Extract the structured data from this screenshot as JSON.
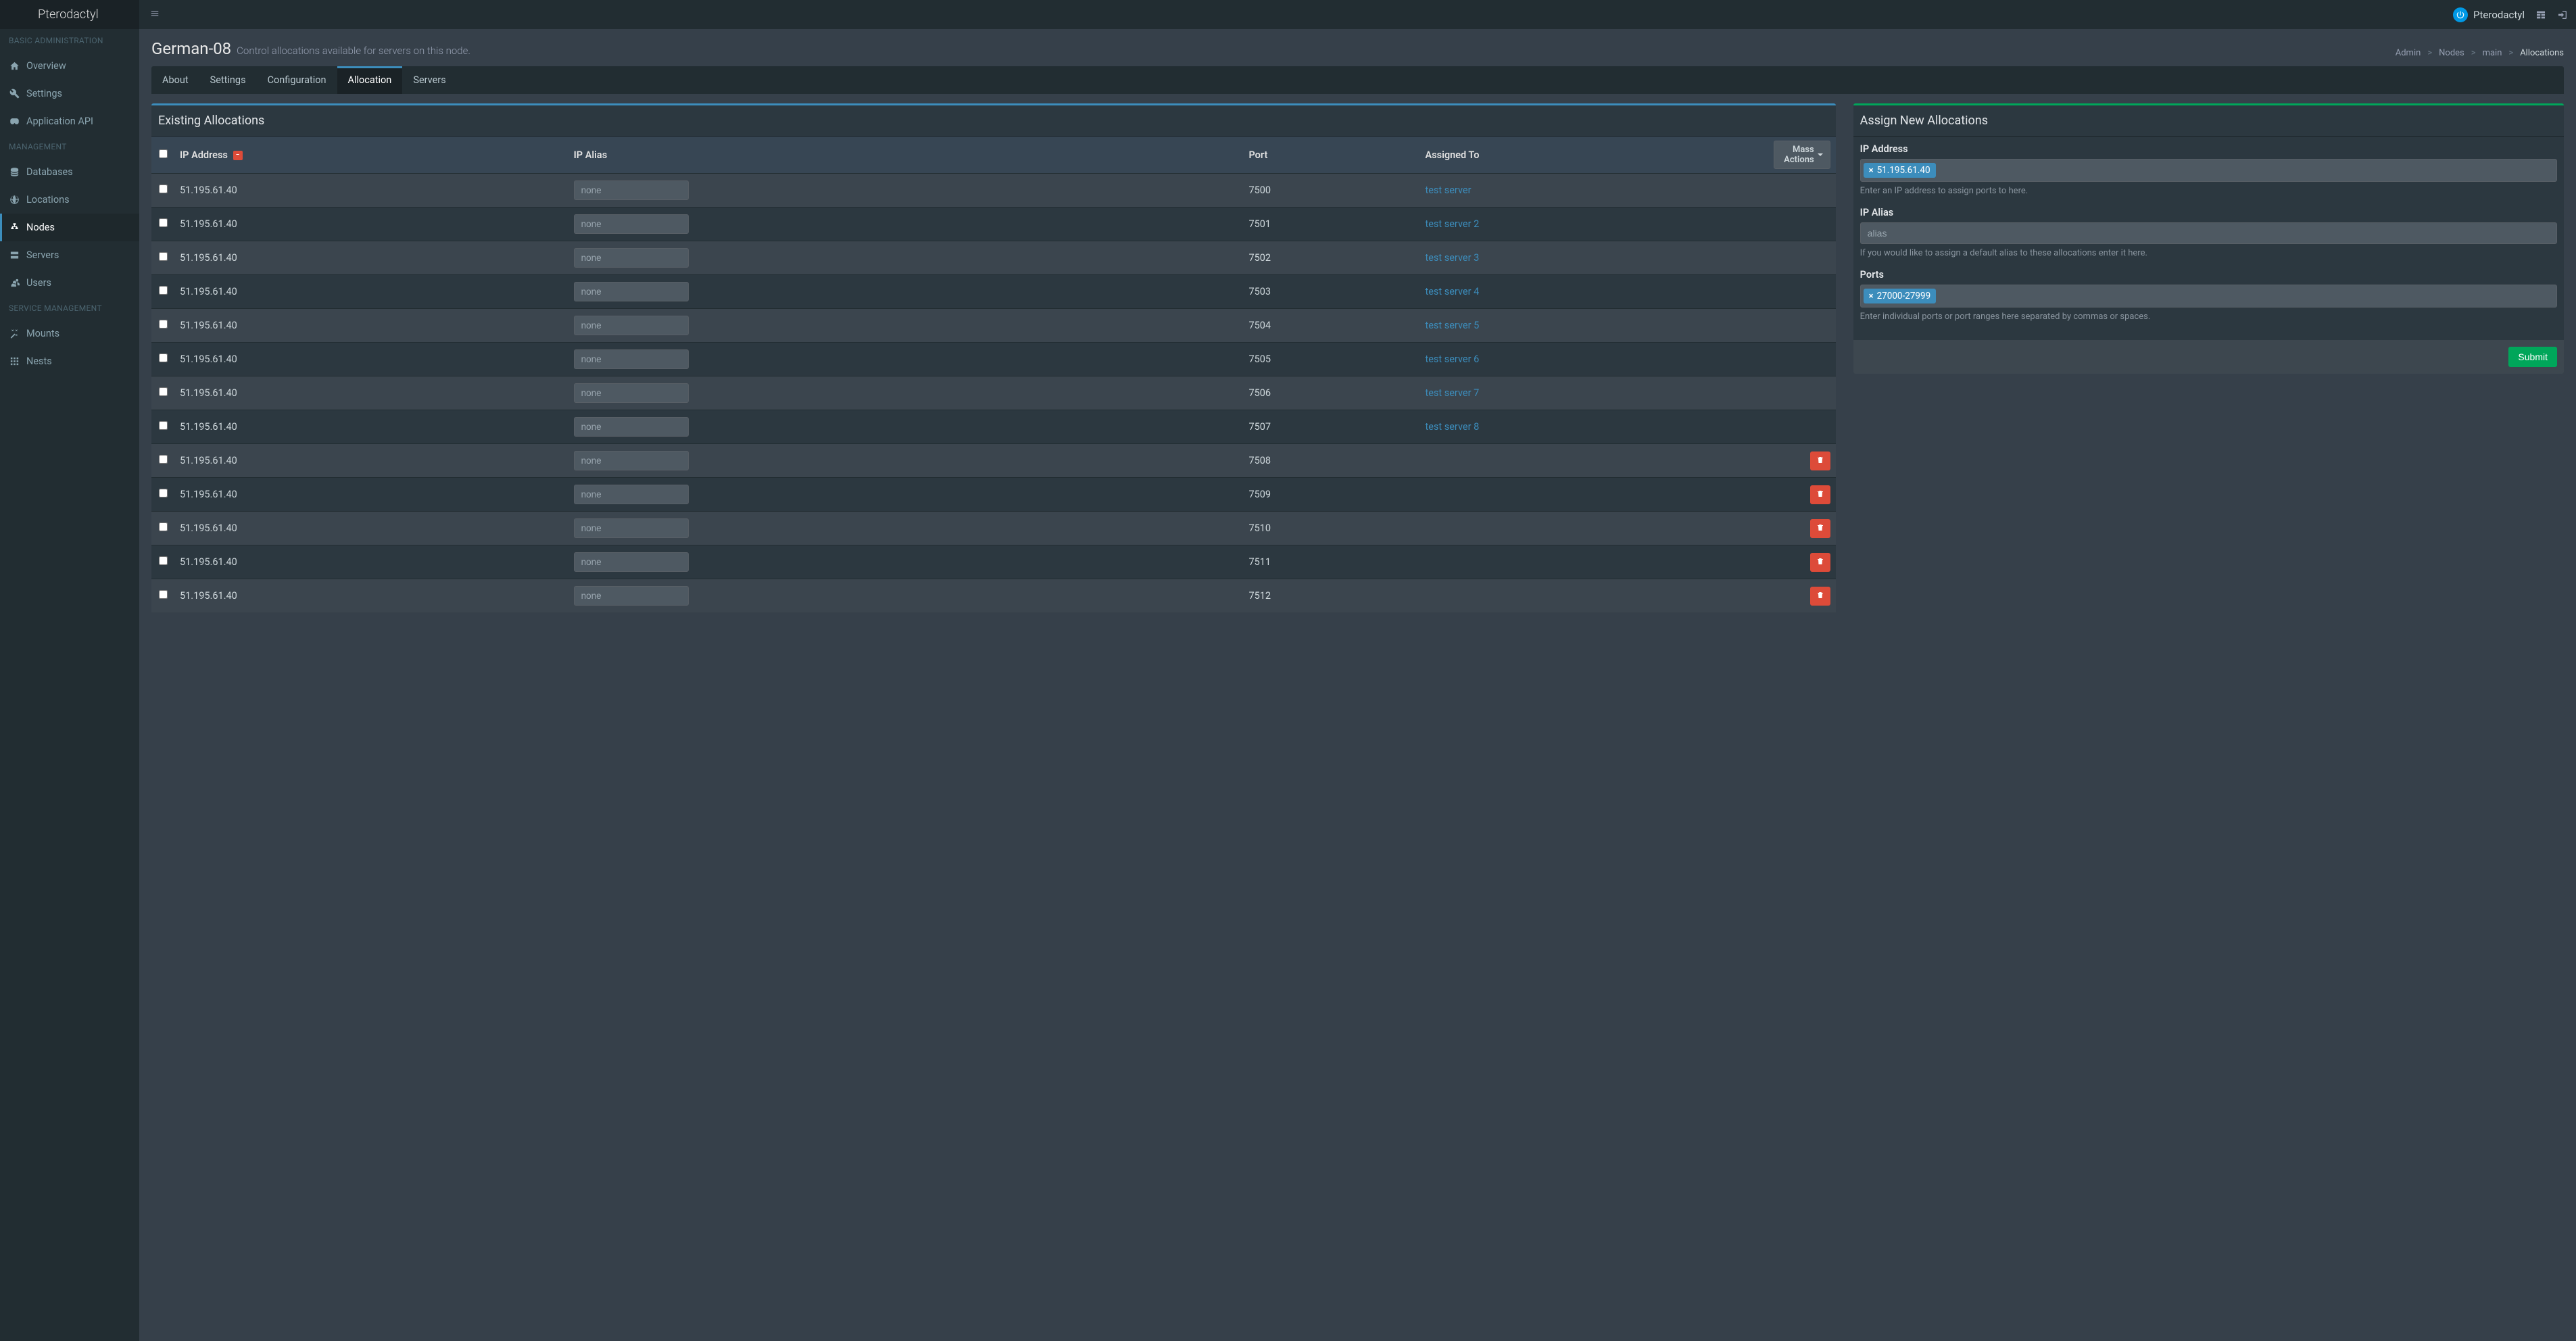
{
  "brand": "Pterodactyl",
  "header": {
    "username": "Pterodactyl"
  },
  "sidebar": {
    "sections": [
      {
        "title": "BASIC ADMINISTRATION",
        "items": [
          {
            "label": "Overview",
            "icon": "home"
          },
          {
            "label": "Settings",
            "icon": "wrench"
          },
          {
            "label": "Application API",
            "icon": "goggles"
          }
        ]
      },
      {
        "title": "MANAGEMENT",
        "items": [
          {
            "label": "Databases",
            "icon": "database"
          },
          {
            "label": "Locations",
            "icon": "globe"
          },
          {
            "label": "Nodes",
            "icon": "sitemap",
            "active": true
          },
          {
            "label": "Servers",
            "icon": "server"
          },
          {
            "label": "Users",
            "icon": "users"
          }
        ]
      },
      {
        "title": "SERVICE MANAGEMENT",
        "items": [
          {
            "label": "Mounts",
            "icon": "magic"
          },
          {
            "label": "Nests",
            "icon": "th"
          }
        ]
      }
    ]
  },
  "page": {
    "title": "German-08",
    "subtitle": "Control allocations available for servers on this node."
  },
  "breadcrumb": {
    "items": [
      "Admin",
      "Nodes",
      "main"
    ],
    "current": "Allocations"
  },
  "tabs": {
    "items": [
      "About",
      "Settings",
      "Configuration",
      "Allocation",
      "Servers"
    ],
    "activeIndex": 3
  },
  "existing": {
    "title": "Existing Allocations",
    "cols": {
      "ip": "IP Address",
      "alias": "IP Alias",
      "port": "Port",
      "assigned": "Assigned To"
    },
    "massActionsLabel": "Mass Actions",
    "aliasPlaceholder": "none",
    "rows": [
      {
        "ip": "51.195.61.40",
        "port": "7500",
        "assigned": "test server"
      },
      {
        "ip": "51.195.61.40",
        "port": "7501",
        "assigned": "test server 2"
      },
      {
        "ip": "51.195.61.40",
        "port": "7502",
        "assigned": "test server 3"
      },
      {
        "ip": "51.195.61.40",
        "port": "7503",
        "assigned": "test server 4"
      },
      {
        "ip": "51.195.61.40",
        "port": "7504",
        "assigned": "test server 5"
      },
      {
        "ip": "51.195.61.40",
        "port": "7505",
        "assigned": "test server 6"
      },
      {
        "ip": "51.195.61.40",
        "port": "7506",
        "assigned": "test server 7"
      },
      {
        "ip": "51.195.61.40",
        "port": "7507",
        "assigned": "test server 8"
      },
      {
        "ip": "51.195.61.40",
        "port": "7508",
        "assigned": null
      },
      {
        "ip": "51.195.61.40",
        "port": "7509",
        "assigned": null
      },
      {
        "ip": "51.195.61.40",
        "port": "7510",
        "assigned": null
      },
      {
        "ip": "51.195.61.40",
        "port": "7511",
        "assigned": null
      },
      {
        "ip": "51.195.61.40",
        "port": "7512",
        "assigned": null
      }
    ]
  },
  "assign": {
    "title": "Assign New Allocations",
    "ip": {
      "label": "IP Address",
      "tag": "51.195.61.40",
      "help": "Enter an IP address to assign ports to here."
    },
    "alias": {
      "label": "IP Alias",
      "placeholder": "alias",
      "help": "If you would like to assign a default alias to these allocations enter it here."
    },
    "ports": {
      "label": "Ports",
      "tag": "27000-27999",
      "help": "Enter individual ports or port ranges here separated by commas or spaces."
    },
    "submit": "Submit"
  }
}
